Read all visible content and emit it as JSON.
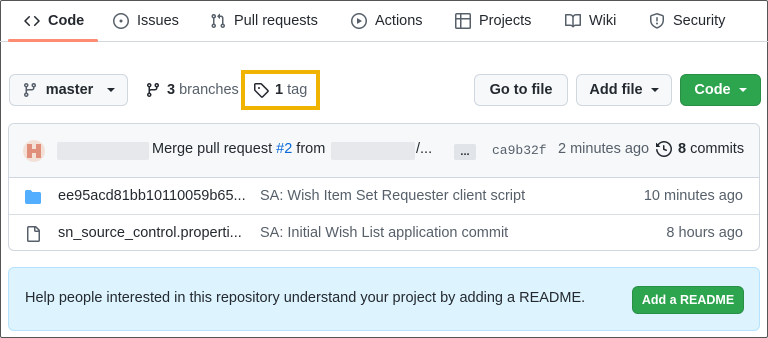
{
  "nav": {
    "tabs": [
      {
        "label": "Code",
        "icon": "code-icon",
        "active": true
      },
      {
        "label": "Issues",
        "icon": "issue-opened-icon"
      },
      {
        "label": "Pull requests",
        "icon": "git-pull-request-icon"
      },
      {
        "label": "Actions",
        "icon": "play-icon"
      },
      {
        "label": "Projects",
        "icon": "table-icon"
      },
      {
        "label": "Wiki",
        "icon": "book-icon"
      },
      {
        "label": "Security",
        "icon": "shield-icon"
      }
    ]
  },
  "toolbar": {
    "branch": "master",
    "branches_count": "3",
    "branches_label": "branches",
    "tags_count": "1",
    "tags_label": "tag",
    "go_to_file": "Go to file",
    "add_file": "Add file",
    "code": "Code"
  },
  "latest_commit": {
    "message_prefix": "Merge pull request",
    "pr_link": "#2",
    "message_from": "from",
    "message_suffix": "/...",
    "more": "...",
    "sha": "ca9b32f",
    "time": "2 minutes ago",
    "commits_count": "8",
    "commits_label": "commits"
  },
  "files": [
    {
      "type": "folder",
      "name": "ee95acd81bb10110059b65...",
      "message": "SA: Wish Item Set Requester client script",
      "time": "10 minutes ago"
    },
    {
      "type": "file",
      "name": "sn_source_control.properti...",
      "message": "SA: Initial Wish List application commit",
      "time": "8 hours ago"
    }
  ],
  "readme_banner": {
    "text": "Help people interested in this repository understand your project by adding a README.",
    "button": "Add a README"
  },
  "colors": {
    "accent_green": "#2da44e",
    "link_blue": "#0969da",
    "highlight_yellow": "#f0b400",
    "active_tab_underline": "#fd8c73"
  }
}
